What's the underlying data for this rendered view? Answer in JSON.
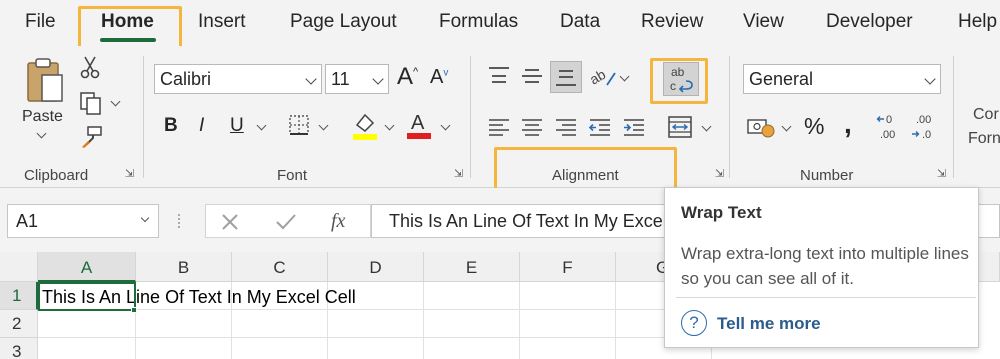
{
  "tabs": [
    "File",
    "Home",
    "Insert",
    "Page Layout",
    "Formulas",
    "Data",
    "Review",
    "View",
    "Developer",
    "Help"
  ],
  "active_tab": "Home",
  "clipboard": {
    "paste_label": "Paste",
    "group_label": "Clipboard"
  },
  "font": {
    "name": "Calibri",
    "size": "11",
    "group_label": "Font"
  },
  "alignment": {
    "group_label": "Alignment"
  },
  "number": {
    "format": "General",
    "group_label": "Number"
  },
  "styles": {
    "partial_label_1": "Cor",
    "partial_label_2": "Forn"
  },
  "formula_bar": {
    "name_box": "A1",
    "content": "This Is An Line Of Text In My Excel Cell",
    "fx": "fx"
  },
  "grid": {
    "columns": [
      "A",
      "B",
      "C",
      "D",
      "E",
      "F",
      "G"
    ],
    "rows": [
      "1",
      "2",
      "3"
    ],
    "a1_value": "This Is An Line Of Text In My Excel Cell"
  },
  "tooltip": {
    "title": "Wrap Text",
    "body": "Wrap extra-long text into multiple lines so you can see all of it.",
    "help_glyph": "?",
    "link": "Tell me more"
  },
  "colors": {
    "accent_green": "#1e6b3c",
    "highlight": "#f4b63c",
    "font_color_red": "#e02020",
    "fill_yellow": "#ffff00"
  }
}
